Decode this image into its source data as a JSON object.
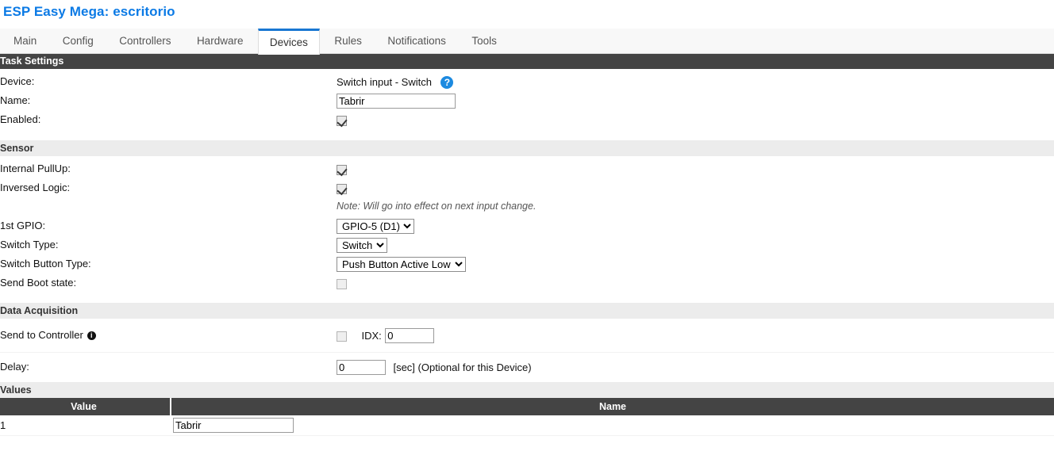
{
  "header": {
    "title": "ESP Easy Mega: escritorio",
    "title_color": "#0b7ae5"
  },
  "tabs": [
    {
      "label": "Main",
      "active": false
    },
    {
      "label": "Config",
      "active": false
    },
    {
      "label": "Controllers",
      "active": false
    },
    {
      "label": "Hardware",
      "active": false
    },
    {
      "label": "Devices",
      "active": true
    },
    {
      "label": "Rules",
      "active": false
    },
    {
      "label": "Notifications",
      "active": false
    },
    {
      "label": "Tools",
      "active": false
    }
  ],
  "sections": {
    "task_settings": "Task Settings",
    "sensor": "Sensor",
    "data_acquisition": "Data Acquisition",
    "values": "Values"
  },
  "task_settings": {
    "device_label": "Device:",
    "device_value": "Switch input - Switch",
    "help_icon": "question-mark-icon",
    "name_label": "Name:",
    "name_value": "Tabrir",
    "enabled_label": "Enabled:",
    "enabled_checked": true
  },
  "sensor": {
    "internal_pullup_label": "Internal PullUp:",
    "internal_pullup_checked": true,
    "inversed_logic_label": "Inversed Logic:",
    "inversed_logic_checked": true,
    "note": "Note: Will go into effect on next input change.",
    "gpio_label": "1st GPIO:",
    "gpio_value": "GPIO-5 (D1)",
    "gpio_options": [
      "GPIO-5 (D1)"
    ],
    "switch_type_label": "Switch Type:",
    "switch_type_value": "Switch",
    "switch_type_options": [
      "Switch"
    ],
    "switch_button_type_label": "Switch Button Type:",
    "switch_button_type_value": "Push Button Active Low",
    "switch_button_type_options": [
      "Push Button Active Low"
    ],
    "send_boot_state_label": "Send Boot state:",
    "send_boot_state_checked": false
  },
  "data_acquisition": {
    "send_to_controller_label": "Send to Controller",
    "send_to_controller_info_icon": "info-icon",
    "send_to_controller_checked": false,
    "idx_label": "IDX:",
    "idx_value": "0",
    "delay_label": "Delay:",
    "delay_value": "0",
    "delay_suffix": "[sec] (Optional for this Device)"
  },
  "values_table": {
    "columns": [
      "Value",
      "Name"
    ],
    "rows": [
      {
        "value": "1",
        "name": "Tabrir"
      }
    ]
  },
  "theme": {
    "section_dark_bg": "#444444",
    "section_light_bg": "#ececec",
    "tab_active_accent": "#1977d2",
    "help_icon_bg": "#1c8ae0"
  }
}
